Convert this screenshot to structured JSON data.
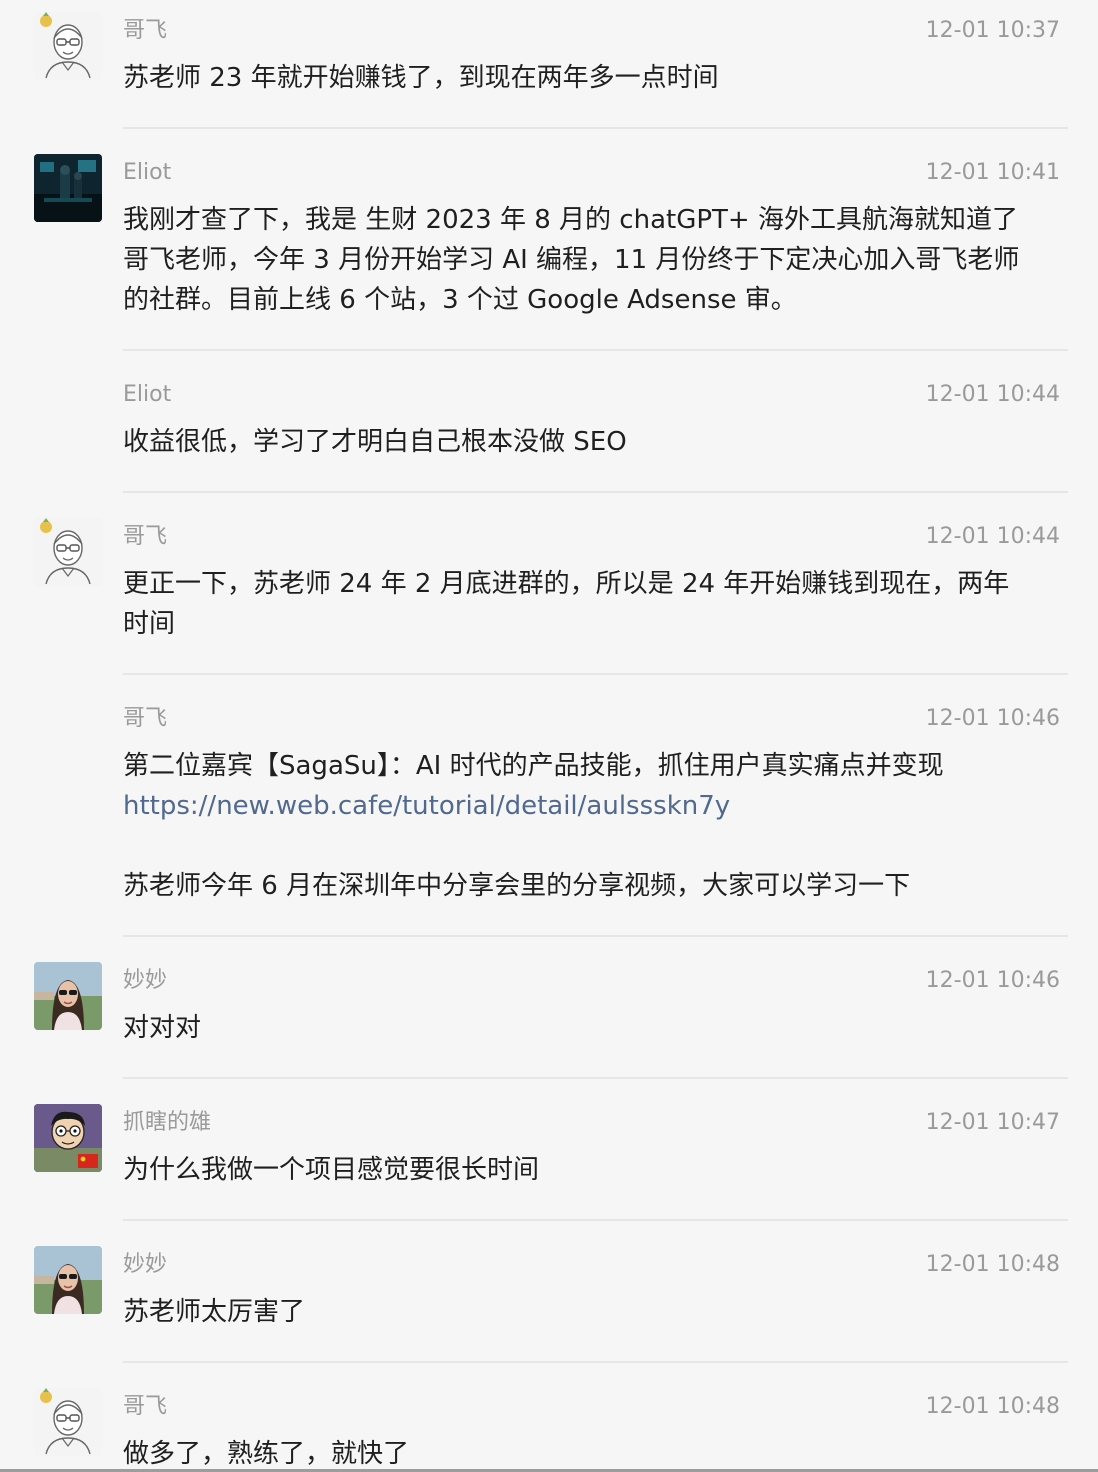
{
  "messages": [
    {
      "sender": "哥飞",
      "time": "12-01 10:37",
      "lines": [
        "苏老师 23 年就开始赚钱了，到现在两年多一点时间"
      ]
    },
    {
      "sender": "Eliot",
      "time": "12-01 10:41",
      "lines": [
        "我刚才查了下，我是 生财 2023 年 8 月的 chatGPT+ 海外工具航海就知道了",
        "哥飞老师，今年 3 月份开始学习 AI 编程，11 月份终于下定决心加入哥飞老师",
        "的社群。目前上线 6 个站，3 个过 Google Adsense 审。"
      ]
    },
    {
      "sender": "Eliot",
      "time": "12-01 10:44",
      "lines": [
        "收益很低，学习了才明白自己根本没做 SEO"
      ]
    },
    {
      "sender": "哥飞",
      "time": "12-01 10:44",
      "lines": [
        "更正一下，苏老师 24 年 2 月底进群的，所以是 24 年开始赚钱到现在，两年",
        "时间"
      ]
    },
    {
      "sender": "哥飞",
      "time": "12-01 10:46",
      "lines": [
        "第二位嘉宾【SagaSu】：AI 时代的产品技能，抓住用户真实痛点并变现",
        "苏老师今年 6 月在深圳年中分享会里的分享视频，大家可以学习一下"
      ],
      "link": "https://new.web.cafe/tutorial/detail/aulssskn7y"
    },
    {
      "sender": "妙妙",
      "time": "12-01 10:46",
      "lines": [
        "对对对"
      ]
    },
    {
      "sender": "抓瞎的雄",
      "time": "12-01 10:47",
      "lines": [
        "为什么我做一个项目感觉要很长时间"
      ]
    },
    {
      "sender": "妙妙",
      "time": "12-01 10:48",
      "lines": [
        "苏老师太厉害了"
      ]
    },
    {
      "sender": "哥飞",
      "time": "12-01 10:48",
      "lines": [
        "做多了，熟练了，就快了"
      ]
    }
  ],
  "avatars": {
    "gefei": "sketch-face-avatar",
    "eliot": "dark-scene-photo-avatar",
    "miaomiao": "woman-sunglasses-photo-avatar",
    "zhuaxia": "cartoon-boy-avatar"
  },
  "colors": {
    "background": "#f6f6f6",
    "text": "#1f1f1f",
    "meta": "#9a9a9a",
    "link": "#51698f",
    "divider": "#e6e6e6"
  }
}
